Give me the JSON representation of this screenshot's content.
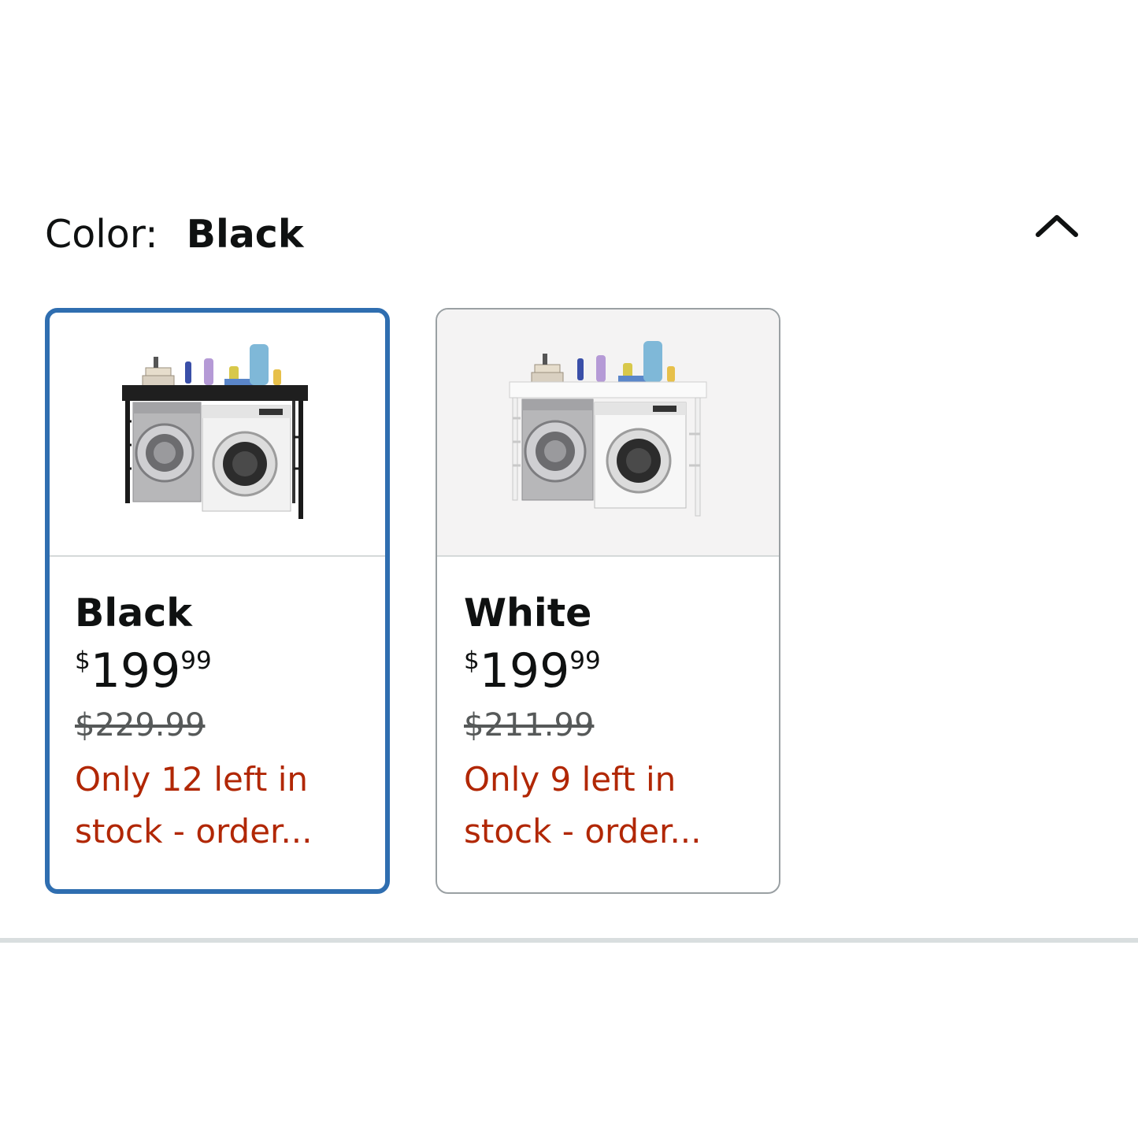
{
  "color_selector": {
    "label": "Color:",
    "selected_value": "Black",
    "collapse_icon": "chevron-up-icon"
  },
  "variants": [
    {
      "name": "Black",
      "price_symbol": "$",
      "price_whole": "199",
      "price_fraction": "99",
      "list_price": "$229.99",
      "stock_line1": "Only 12 left in",
      "stock_line2": "stock - order...",
      "selected": true,
      "frame_color": "#1a1a1a",
      "image_icon": "washer-dryer-shelf-black"
    },
    {
      "name": "White",
      "price_symbol": "$",
      "price_whole": "199",
      "price_fraction": "99",
      "list_price": "$211.99",
      "stock_line1": "Only 9 left in",
      "stock_line2": "stock - order...",
      "selected": false,
      "frame_color": "#f5f5f5",
      "image_icon": "washer-dryer-shelf-white"
    }
  ],
  "colors": {
    "selected_border": "#2f6eb0",
    "unselected_border": "#9aa0a3",
    "stock_text": "#b12704",
    "list_price_text": "#565959"
  }
}
